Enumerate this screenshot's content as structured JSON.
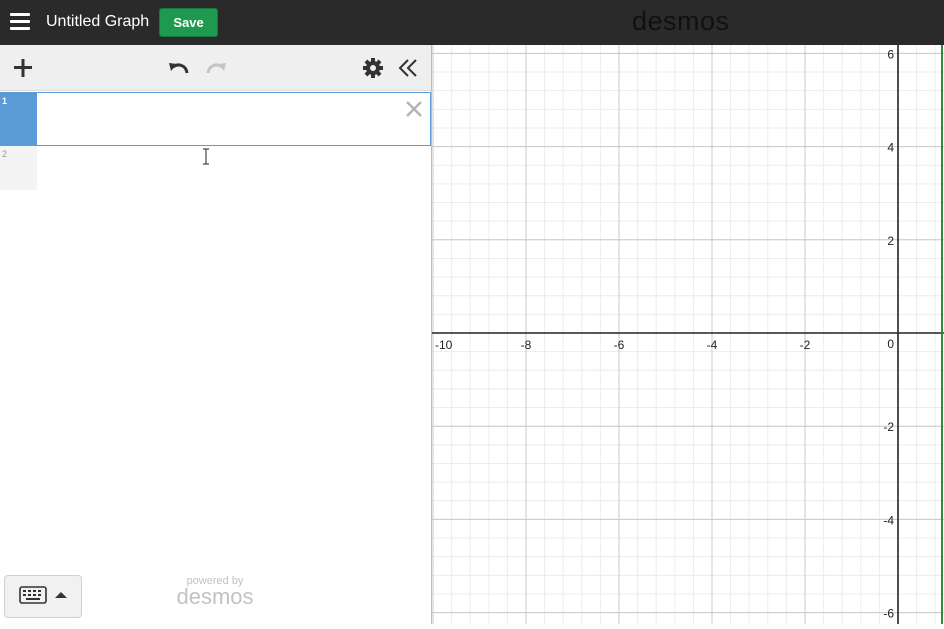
{
  "header": {
    "menu_icon": "hamburger-menu-icon",
    "title": "Untitled Graph",
    "save_label": "Save",
    "logo_text": "desmos"
  },
  "toolbar": {
    "icons": [
      "plus-icon",
      "undo-icon",
      "redo-icon",
      "gear-icon",
      "collapse-double-chevron-icon"
    ]
  },
  "expressions": [
    {
      "number": "1",
      "value": "",
      "selected": true
    },
    {
      "number": "2",
      "value": "",
      "selected": false
    }
  ],
  "footer": {
    "keyboard_icon": "keyboard-icon",
    "powered_by": "powered by",
    "powered_logo": "desmos"
  },
  "graph": {
    "x_range": [
      -10,
      0.5
    ],
    "y_range": [
      -6.2,
      6.2
    ],
    "x_tick_labels": [
      "-10",
      "-8",
      "-6",
      "-4",
      "-2",
      "0"
    ],
    "y_tick_labels": [
      "6",
      "4",
      "2",
      "-2",
      "-4",
      "-6"
    ],
    "colors": {
      "save_button": "#1d9a4f",
      "selected_row": "#5b9bd5",
      "axis": "#222222"
    }
  }
}
